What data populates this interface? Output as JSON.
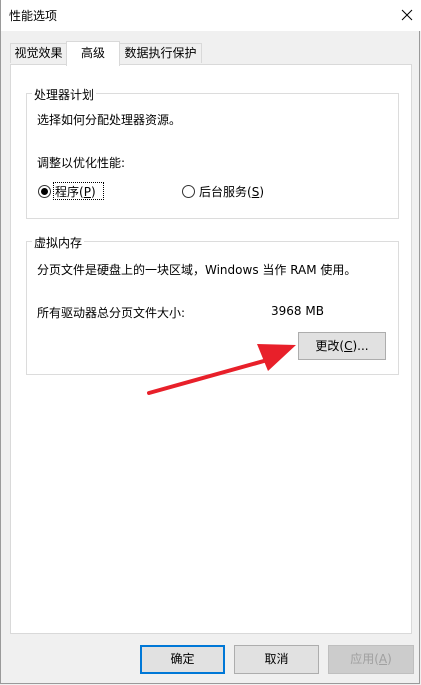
{
  "window": {
    "title": "性能选项"
  },
  "tabs": [
    {
      "label": "视觉效果"
    },
    {
      "label": "高级"
    },
    {
      "label": "数据执行保护"
    }
  ],
  "processor_group": {
    "legend": "处理器计划",
    "description": "选择如何分配处理器资源。",
    "adjust_label": "调整以优化性能:",
    "options": [
      {
        "label": "程序(",
        "hotkey": "P",
        "suffix": ")",
        "selected": true
      },
      {
        "label": "后台服务(",
        "hotkey": "S",
        "suffix": ")",
        "selected": false
      }
    ]
  },
  "vm_group": {
    "legend": "虚拟内存",
    "description": "分页文件是硬盘上的一块区域，Windows 当作 RAM 使用。",
    "total_label": "所有驱动器总分页文件大小:",
    "total_value": "3968 MB",
    "change_button": {
      "label": "更改(",
      "hotkey": "C",
      "suffix": ")..."
    }
  },
  "footer": {
    "ok_label": "确定",
    "cancel_label": "取消",
    "apply_label": "应用(",
    "apply_hotkey": "A",
    "apply_suffix": ")"
  },
  "colors": {
    "annotation_arrow": "#e8202a",
    "focus_border": "#0078d7"
  }
}
